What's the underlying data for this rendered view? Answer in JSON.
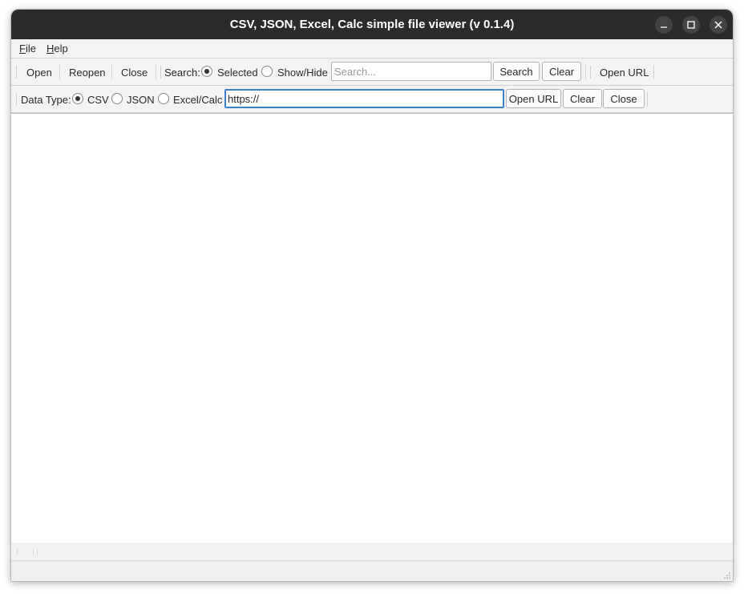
{
  "window": {
    "title": "CSV, JSON, Excel, Calc simple file viewer (v 0.1.4)",
    "controls": [
      "minimize-icon",
      "maximize-icon",
      "close-icon"
    ]
  },
  "menubar": {
    "file": {
      "mnemonic": "F",
      "rest": "ile"
    },
    "help": {
      "mnemonic": "H",
      "rest": "elp"
    }
  },
  "toolbar1": {
    "open": "Open",
    "reopen": "Reopen",
    "close": "Close",
    "search_label": "Search:",
    "search_mode": {
      "options": [
        "Selected",
        "Show/Hide"
      ],
      "selected": "Selected"
    },
    "search_input": {
      "value": "",
      "placeholder": "Search..."
    },
    "search_button": "Search",
    "clear_button": "Clear",
    "open_url": "Open URL"
  },
  "toolbar2": {
    "data_type_label": "Data Type:",
    "data_type": {
      "options": [
        "CSV",
        "JSON",
        "Excel/Calc"
      ],
      "selected": "CSV"
    },
    "url_input": {
      "value": "https://"
    },
    "open_url_button": "Open URL",
    "clear_button": "Clear",
    "close_button": "Close"
  },
  "colors": {
    "titlebar": "#2b2b2b",
    "focus_border": "#3d7fc8",
    "window_bg": "#f3f3f3"
  }
}
